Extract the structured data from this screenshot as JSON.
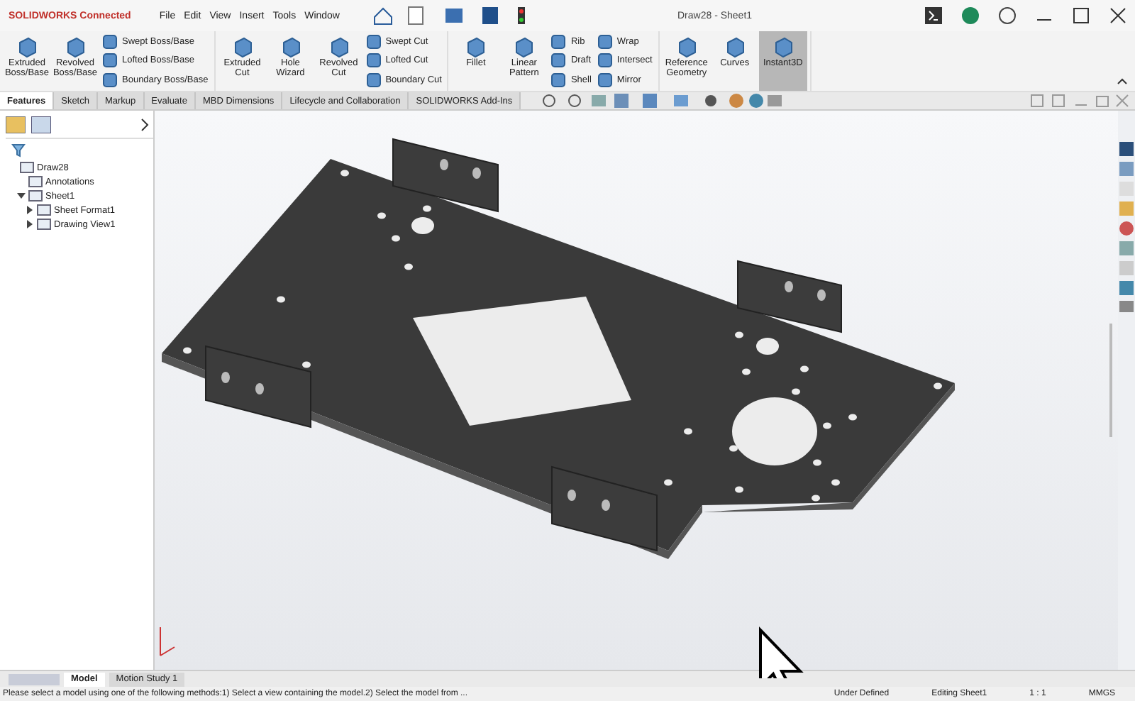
{
  "title_bar": {
    "brand": "SOLIDWORKS Connected",
    "menus": [
      "File",
      "Edit",
      "View",
      "Insert",
      "Tools",
      "Window"
    ],
    "document_title": "Draw28 - Sheet1"
  },
  "ribbon": {
    "groups": [
      {
        "items": [
          {
            "kind": "large",
            "label": "Extruded Boss/Base",
            "selected": false
          },
          {
            "kind": "large",
            "label": "Revolved Boss/Base",
            "selected": false
          },
          {
            "kind": "stack",
            "tools": [
              "Swept Boss/Base",
              "Lofted Boss/Base",
              "Boundary Boss/Base"
            ]
          }
        ]
      },
      {
        "items": [
          {
            "kind": "large",
            "label": "Extruded Cut",
            "selected": false
          },
          {
            "kind": "large",
            "label": "Hole Wizard",
            "selected": false
          },
          {
            "kind": "large",
            "label": "Revolved Cut",
            "selected": false
          },
          {
            "kind": "stack",
            "tools": [
              "Swept Cut",
              "Lofted Cut",
              "Boundary Cut"
            ]
          }
        ]
      },
      {
        "items": [
          {
            "kind": "large",
            "label": "Fillet",
            "selected": false
          },
          {
            "kind": "large",
            "label": "Linear Pattern",
            "selected": false
          },
          {
            "kind": "stack",
            "tools": [
              "Rib",
              "Draft",
              "Shell"
            ]
          },
          {
            "kind": "stack",
            "tools": [
              "Wrap",
              "Intersect",
              "Mirror"
            ]
          }
        ]
      },
      {
        "items": [
          {
            "kind": "large",
            "label": "Reference Geometry",
            "selected": false
          },
          {
            "kind": "large",
            "label": "Curves",
            "selected": false
          },
          {
            "kind": "large",
            "label": "Instant3D",
            "selected": true
          }
        ]
      }
    ]
  },
  "command_tabs": [
    {
      "label": "Features",
      "selected": true
    },
    {
      "label": "Sketch",
      "selected": false
    },
    {
      "label": "Markup",
      "selected": false
    },
    {
      "label": "Evaluate",
      "selected": false
    },
    {
      "label": "MBD Dimensions",
      "selected": false
    },
    {
      "label": "Lifecycle and Collaboration",
      "selected": false
    },
    {
      "label": "SOLIDWORKS Add-Ins",
      "selected": false
    }
  ],
  "feature_tree": [
    {
      "label": "Draw28",
      "children": [
        {
          "label": "Annotations"
        },
        {
          "label": "Sheet1",
          "expanded": true,
          "children": [
            {
              "label": "Sheet Format1",
              "expanded": false
            },
            {
              "label": "Drawing View1",
              "expanded": false
            }
          ]
        }
      ]
    }
  ],
  "bottom_tabs": [
    {
      "label": "Model",
      "selected": true
    },
    {
      "label": "Motion Study 1",
      "selected": false
    }
  ],
  "status_bar": {
    "message": "Please select a model using one of the following methods:1) Select a view containing the model.2) Select the model from ...",
    "fields": [
      "Under Defined",
      "Editing Sheet1",
      "1 : 1",
      "MMGS"
    ]
  }
}
